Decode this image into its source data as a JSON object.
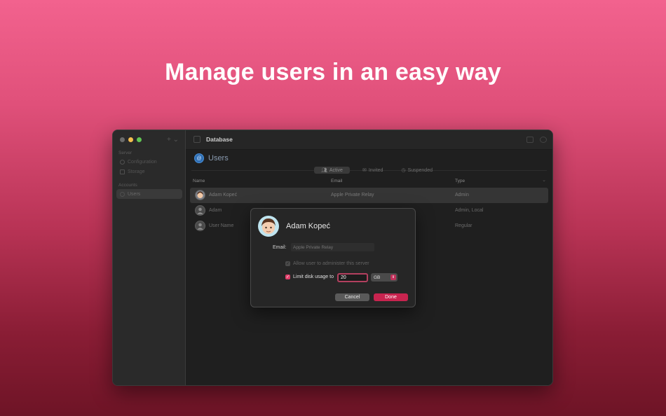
{
  "headline": "Manage users in an easy way",
  "sidebar": {
    "sections": [
      {
        "title": "Server",
        "items": [
          {
            "label": "Configuration",
            "icon": "gear-icon"
          },
          {
            "label": "Storage",
            "icon": "folder-icon"
          }
        ]
      },
      {
        "title": "Accounts",
        "items": [
          {
            "label": "Users",
            "icon": "person-icon",
            "active": true
          }
        ]
      }
    ]
  },
  "toolbar": {
    "title": "Database"
  },
  "page": {
    "title": "Users",
    "tabs": [
      {
        "label": "Active",
        "icon": "people-icon",
        "active": true
      },
      {
        "label": "Invited",
        "icon": "envelope-icon"
      },
      {
        "label": "Suspended",
        "icon": "clock-icon"
      }
    ],
    "columns": {
      "name": "Name",
      "email": "Email",
      "type": "Type"
    }
  },
  "users": [
    {
      "name": "Adam Kopeć",
      "email": "Apple Private Relay",
      "type": "Admin",
      "selected": true
    },
    {
      "name": "Adam",
      "email": "",
      "type": "Admin, Local"
    },
    {
      "name": "User Name",
      "email": "",
      "type": "Regular"
    }
  ],
  "dialog": {
    "name": "Adam Kopeć",
    "email_label": "Email:",
    "email_placeholder": "Apple Private Relay",
    "admin_label": "Allow user to administer this server",
    "admin_checked": true,
    "disk_label": "Limit disk usage to",
    "disk_checked": true,
    "disk_value": "20",
    "disk_unit": "GB",
    "cancel_label": "Cancel",
    "done_label": "Done"
  },
  "colors": {
    "accent": "#c8244f",
    "background_top": "#f2628e",
    "background_bottom": "#6e1426"
  }
}
